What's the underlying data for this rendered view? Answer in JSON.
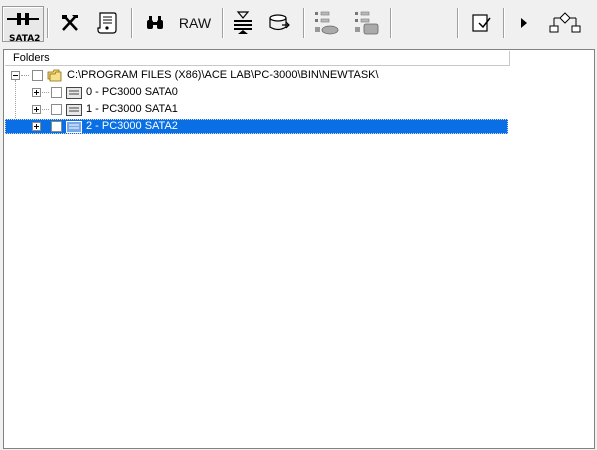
{
  "toolbar": {
    "sata_label": "SATA2",
    "raw_label": "RAW",
    "icons": [
      "sata2-connector-icon",
      "tools-icon",
      "scroll-icon",
      "binoculars-icon",
      "raw-button",
      "drive-stack-icon",
      "disk-export-icon",
      "tree-list-icon",
      "tree-drive-icon",
      "notepad-icon",
      "play-icon",
      "flowchart-icon"
    ]
  },
  "panel": {
    "header": "Folders",
    "root": "C:\\PROGRAM FILES (X86)\\ACE LAB\\PC-3000\\BIN\\NEWTASK\\",
    "items": [
      {
        "label": "0 - PC3000 SATA0",
        "selected": false
      },
      {
        "label": "1 - PC3000 SATA1",
        "selected": false
      },
      {
        "label": "2 - PC3000 SATA2",
        "selected": true
      }
    ]
  },
  "colors": {
    "selection": "#0a6fe4",
    "toolbar_bg": "#f0f0f0"
  }
}
